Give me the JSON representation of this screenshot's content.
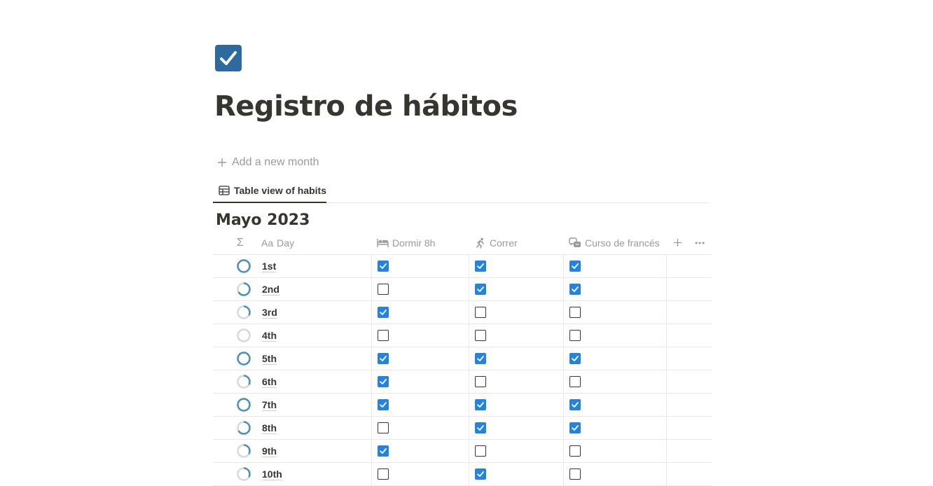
{
  "page": {
    "title": "Registro de hábitos",
    "icon": "checkbox-icon",
    "add_month_label": "Add a new month"
  },
  "view_tabs": [
    {
      "label": "Table view of habits",
      "icon": "table-icon",
      "active": true
    }
  ],
  "group": {
    "title": "Mayo 2023"
  },
  "table": {
    "columns": [
      {
        "key": "progress",
        "label": "Σ",
        "icon": "sigma-icon"
      },
      {
        "key": "day",
        "label": "Day",
        "prefix": "Aa",
        "icon": "title-property-icon"
      },
      {
        "key": "sleep",
        "label": "Dormir 8h",
        "icon": "bed-icon"
      },
      {
        "key": "run",
        "label": "Correr",
        "icon": "running-icon"
      },
      {
        "key": "french",
        "label": "Curso de francés",
        "icon": "language-icon"
      }
    ],
    "add_column": "add-column-icon",
    "more": "more-options-icon",
    "rows": [
      {
        "day": "1st",
        "sleep": true,
        "run": true,
        "french": true,
        "progress": 1.0
      },
      {
        "day": "2nd",
        "sleep": false,
        "run": true,
        "french": true,
        "progress": 0.667
      },
      {
        "day": "3rd",
        "sleep": true,
        "run": false,
        "french": false,
        "progress": 0.333
      },
      {
        "day": "4th",
        "sleep": false,
        "run": false,
        "french": false,
        "progress": 0.0
      },
      {
        "day": "5th",
        "sleep": true,
        "run": true,
        "french": true,
        "progress": 1.0
      },
      {
        "day": "6th",
        "sleep": true,
        "run": false,
        "french": false,
        "progress": 0.333
      },
      {
        "day": "7th",
        "sleep": true,
        "run": true,
        "french": true,
        "progress": 1.0
      },
      {
        "day": "8th",
        "sleep": false,
        "run": true,
        "french": true,
        "progress": 0.667
      },
      {
        "day": "9th",
        "sleep": true,
        "run": false,
        "french": false,
        "progress": 0.333
      },
      {
        "day": "10th",
        "sleep": false,
        "run": true,
        "french": false,
        "progress": 0.333
      }
    ]
  },
  "colors": {
    "checkbox_checked": "#2383e2",
    "progress_ring": "#4b8ec0",
    "progress_track": "#d8d8d6",
    "page_icon": "#2f6a9e"
  }
}
